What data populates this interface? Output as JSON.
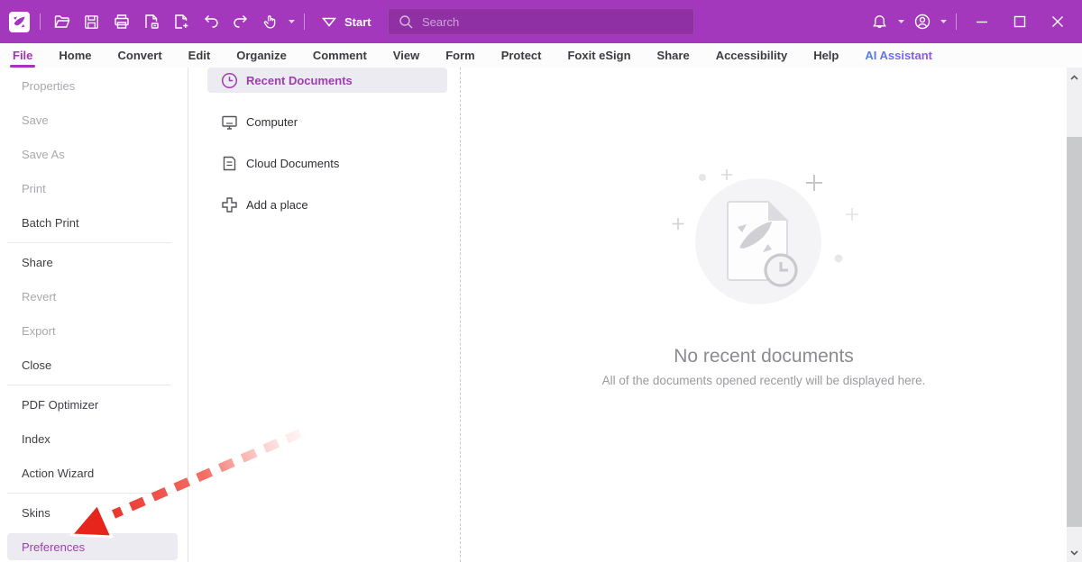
{
  "titlebar": {
    "start_label": "Start",
    "search_placeholder": "Search",
    "quick_access_icons": [
      "foxit-logo",
      "open-folder-icon",
      "save-icon",
      "print-icon",
      "pdf-minus-icon",
      "create-pdf-plus-icon",
      "undo-icon",
      "redo-icon",
      "hand-tool-icon"
    ],
    "right_icons": [
      "bell-icon",
      "account-icon",
      "minimize-icon",
      "maximize-icon",
      "close-icon"
    ]
  },
  "menubar": {
    "items": [
      {
        "label": "File",
        "active": true
      },
      {
        "label": "Home"
      },
      {
        "label": "Convert"
      },
      {
        "label": "Edit"
      },
      {
        "label": "Organize"
      },
      {
        "label": "Comment"
      },
      {
        "label": "View"
      },
      {
        "label": "Form"
      },
      {
        "label": "Protect"
      },
      {
        "label": "Foxit eSign"
      },
      {
        "label": "Share"
      },
      {
        "label": "Accessibility"
      },
      {
        "label": "Help"
      },
      {
        "label": "AI Assistant",
        "gradient": true
      }
    ]
  },
  "sidebar": {
    "groups": [
      {
        "items": [
          {
            "label": "Properties",
            "disabled": true
          },
          {
            "label": "Save",
            "disabled": true
          },
          {
            "label": "Save As",
            "disabled": true
          },
          {
            "label": "Print",
            "disabled": true
          },
          {
            "label": "Batch Print",
            "disabled": false
          }
        ]
      },
      {
        "items": [
          {
            "label": "Share",
            "disabled": false
          },
          {
            "label": "Revert",
            "disabled": true
          },
          {
            "label": "Export",
            "disabled": true
          },
          {
            "label": "Close",
            "disabled": false
          }
        ]
      },
      {
        "items": [
          {
            "label": "PDF Optimizer",
            "disabled": false
          },
          {
            "label": "Index",
            "disabled": false
          },
          {
            "label": "Action Wizard",
            "disabled": false
          }
        ]
      },
      {
        "items": [
          {
            "label": "Skins",
            "disabled": false
          },
          {
            "label": "Preferences",
            "disabled": false,
            "selected": true
          }
        ]
      }
    ]
  },
  "places": {
    "items": [
      {
        "label": "Recent Documents",
        "icon": "clock-icon",
        "selected": true
      },
      {
        "label": "Computer",
        "icon": "monitor-icon",
        "selected": false
      },
      {
        "label": "Cloud Documents",
        "icon": "document-icon",
        "selected": false
      },
      {
        "label": "Add a place",
        "icon": "plus-icon",
        "selected": false
      }
    ]
  },
  "content": {
    "empty_title": "No recent documents",
    "empty_subtitle": "All of the documents opened recently will be displayed here."
  },
  "annotation": {
    "type": "red-dashed-arrow",
    "points_to": "Preferences"
  },
  "colors": {
    "titlebar_bg": "#A338BC",
    "accent_purple": "#A233BC",
    "selected_bg": "#ECEBF1",
    "arrow_red": "#E8251C",
    "ai_gradient_start": "#4F7DF7",
    "ai_gradient_end": "#8E53F0",
    "disabled_text": "#A8A8AE"
  }
}
